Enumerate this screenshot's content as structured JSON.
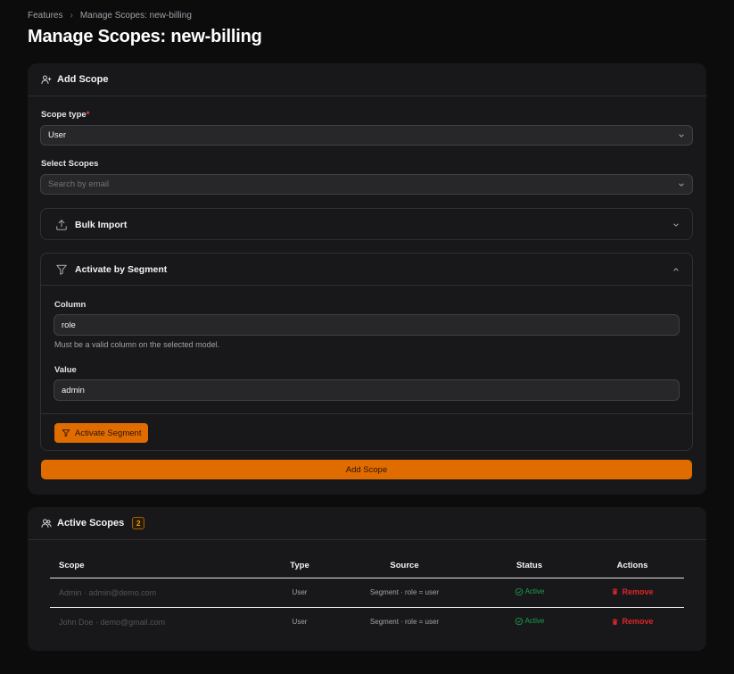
{
  "breadcrumb": {
    "items": [
      "Features",
      "Manage Scopes: new-billing"
    ]
  },
  "page": {
    "title": "Manage Scopes: new-billing"
  },
  "add_scope": {
    "header": "Add Scope",
    "scope_type": {
      "label": "Scope type",
      "required_mark": "*",
      "value": "User"
    },
    "select_scopes": {
      "label": "Select Scopes",
      "placeholder": "Search by email"
    },
    "bulk_import": {
      "title": "Bulk Import"
    },
    "segment": {
      "title": "Activate by Segment",
      "column_label": "Column",
      "column_value": "role",
      "column_hint": "Must be a valid column on the selected model.",
      "value_label": "Value",
      "value_value": "admin",
      "activate_button": "Activate Segment"
    },
    "submit_button": "Add Scope"
  },
  "active_scopes": {
    "header": "Active Scopes",
    "count": "2",
    "columns": [
      "Scope",
      "Type",
      "Source",
      "Status",
      "Actions"
    ],
    "rows": [
      {
        "scope": "Admin · admin@demo.com",
        "type": "User",
        "source": "Segment · role = user",
        "status": "Active",
        "action": "Remove"
      },
      {
        "scope": "John Doe · demo@gmail.com",
        "type": "User",
        "source": "Segment · role = user",
        "status": "Active",
        "action": "Remove"
      }
    ]
  },
  "colors": {
    "accent": "#e06c00",
    "success": "#16a34a",
    "danger": "#dc2626",
    "card_bg": "#18181b",
    "page_bg": "#0c0c0d"
  }
}
